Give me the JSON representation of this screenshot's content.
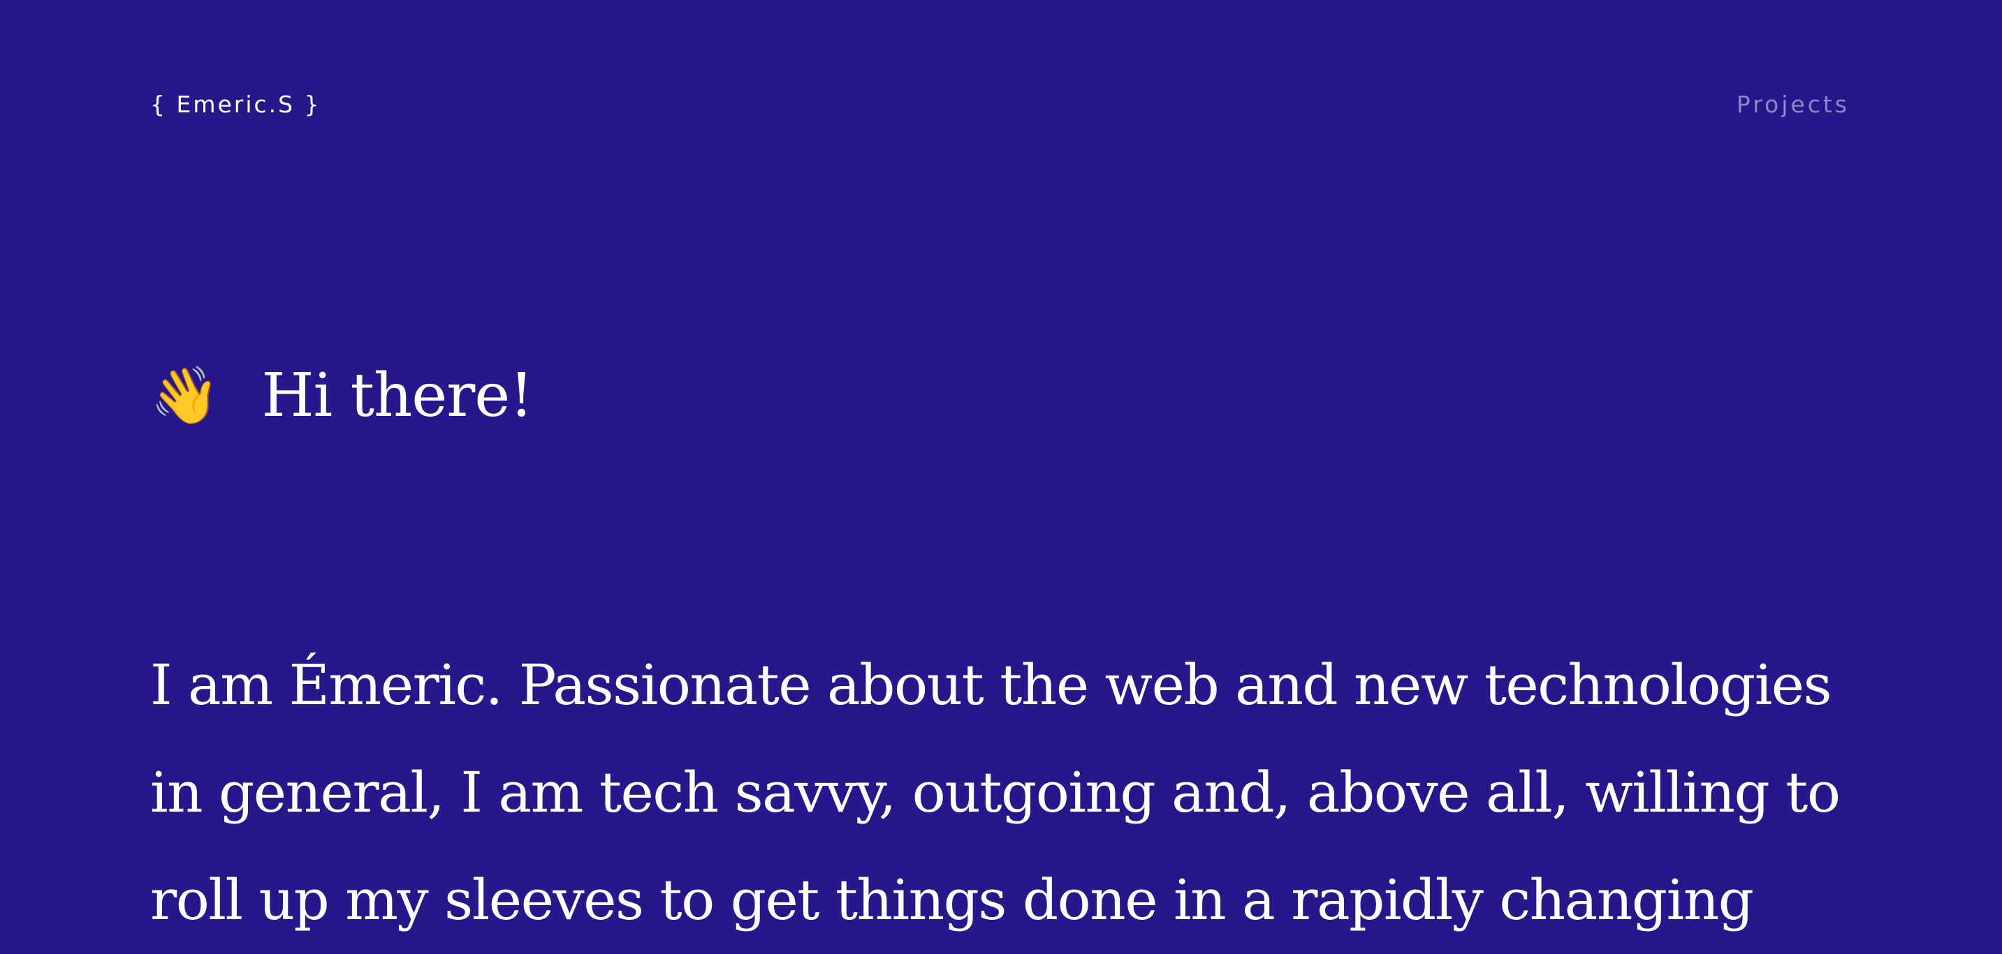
{
  "header": {
    "logo": "{ Emeric.S }",
    "nav": {
      "projects_label": "Projects"
    }
  },
  "hero": {
    "icon": "waving-hand-icon",
    "icon_glyph": "👋",
    "greeting": "Hi there!",
    "intro": "I am Émeric. Passionate about the web and new technologies in general, I am tech savvy, outgoing and, above all, willing to roll up my sleeves to get things done in a rapidly changing"
  },
  "colors": {
    "background": "#26188a",
    "text": "#ffffff",
    "nav_link": "#8f86c9"
  }
}
